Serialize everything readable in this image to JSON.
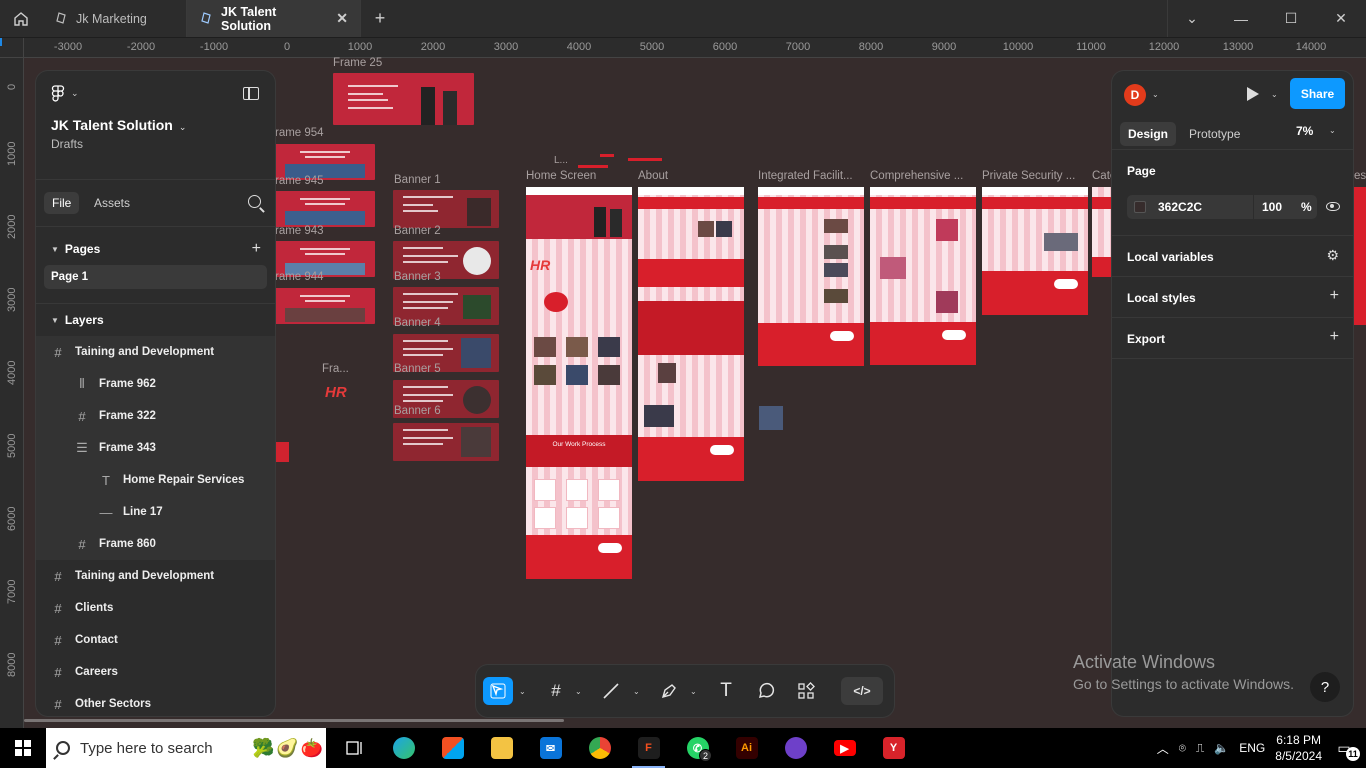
{
  "tabs": {
    "items": [
      {
        "label": "Jk Marketing",
        "active": false
      },
      {
        "label": "JK Talent Solution",
        "active": true
      }
    ]
  },
  "ruler": {
    "h_ticks": [
      "-3000",
      "-2000",
      "-1000",
      "0",
      "1000",
      "2000",
      "3000",
      "4000",
      "5000",
      "6000",
      "7000",
      "8000",
      "9000",
      "10000",
      "11000",
      "12000",
      "13000",
      "14000"
    ],
    "v_ticks": [
      "0",
      "1000",
      "2000",
      "3000",
      "4000",
      "5000",
      "6000",
      "7000",
      "8000"
    ]
  },
  "canvas": {
    "labels": {
      "frame25": "Frame 25",
      "frame954": "rame 954",
      "frame945": "rame 945",
      "frame943": "rame 943",
      "frame944": "rame 944",
      "fra": "Fra...",
      "banner1": "Banner 1",
      "banner2": "Banner 2",
      "banner3": "Banner 3",
      "banner4": "Banner 4",
      "banner5": "Banner 5",
      "banner6": "Banner 6",
      "l": "L...",
      "home": "Home Screen",
      "about": "About",
      "integrated": "Integrated Facilit...",
      "comprehensive": "Comprehensive ...",
      "private": "Private Security ...",
      "cate": "Cate",
      "es": "es"
    },
    "page_texts": {
      "work_process": "Our Work Process",
      "hr": "HR"
    }
  },
  "left_panel": {
    "project_name": "JK Talent Solution",
    "project_sub": "Drafts",
    "tab_file": "File",
    "tab_assets": "Assets",
    "pages_title": "Pages",
    "page1": "Page 1",
    "layers_title": "Layers",
    "layers": [
      {
        "label": "Taining and Development",
        "icon": "#",
        "level": 0
      },
      {
        "label": "Frame 962",
        "icon": "|||",
        "level": 1
      },
      {
        "label": "Frame 322",
        "icon": "#",
        "level": 1
      },
      {
        "label": "Frame 343",
        "icon": "≡",
        "level": 1
      },
      {
        "label": "Home Repair Services",
        "icon": "T",
        "level": 2
      },
      {
        "label": "Line 17",
        "icon": "—",
        "level": 2
      },
      {
        "label": "Frame 860",
        "icon": "#",
        "level": 1
      },
      {
        "label": "Taining and Development",
        "icon": "#",
        "level": 0
      },
      {
        "label": "Clients",
        "icon": "#",
        "level": 0
      },
      {
        "label": "Contact",
        "icon": "#",
        "level": 0
      },
      {
        "label": "Careers",
        "icon": "#",
        "level": 0
      },
      {
        "label": "Other Sectors",
        "icon": "#",
        "level": 0
      }
    ]
  },
  "right_panel": {
    "avatar": "D",
    "share": "Share",
    "tab_design": "Design",
    "tab_prototype": "Prototype",
    "zoom": "7%",
    "page_title": "Page",
    "color_hex": "362C2C",
    "opacity": "100",
    "opacity_unit": "%",
    "local_variables": "Local variables",
    "local_styles": "Local styles",
    "export": "Export"
  },
  "toolbar": {
    "dev_label": "</>"
  },
  "windows": {
    "activate_title": "Activate Windows",
    "activate_sub": "Go to Settings to activate Windows.",
    "help": "?"
  },
  "taskbar": {
    "search_placeholder": "Type here to search",
    "lang": "ENG",
    "time": "6:18 PM",
    "date": "8/5/2024",
    "whatsapp_badge": "2",
    "notif_count": "11"
  },
  "colors": {
    "canvas_bg": "#362C2C",
    "accent": "#0D99FF",
    "brand_red": "#D81F2B"
  }
}
